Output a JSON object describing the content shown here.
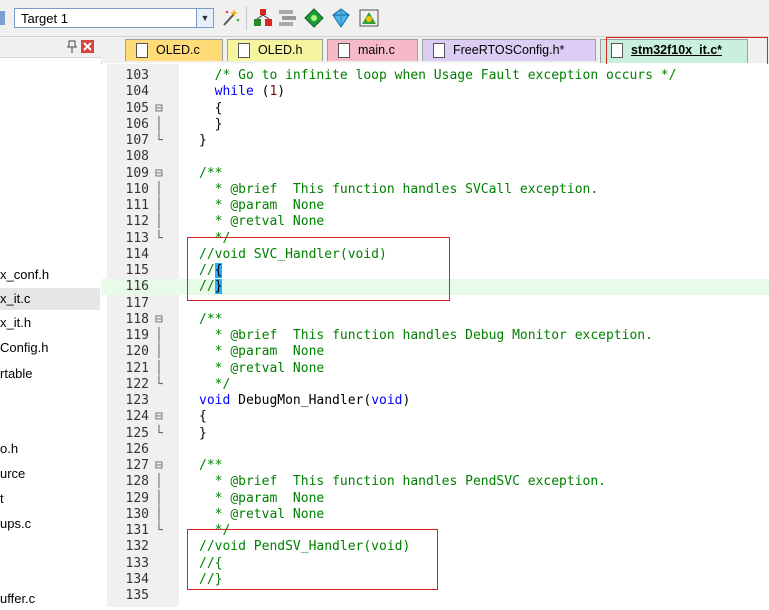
{
  "toolbar": {
    "target": "Target 1",
    "icons": [
      "magic-wand",
      "manage-project-items",
      "file-extensions",
      "select-packs",
      "manage-rte",
      "pack-installer"
    ]
  },
  "left_panel": {
    "items": [
      "x_conf.h",
      "x_it.c",
      "x_it.h",
      "Config.h",
      "rtable",
      "o.h",
      "urce",
      "t",
      "ups.c",
      "uffer.c"
    ],
    "selected_index": 1
  },
  "tabs": [
    {
      "label": "OLED.c",
      "color": "#ffdc78"
    },
    {
      "label": "OLED.h",
      "color": "#f5f5a0"
    },
    {
      "label": "main.c",
      "color": "#f5b9c8"
    },
    {
      "label": "FreeRTOSConfig.h*",
      "color": "#dccdf5"
    },
    {
      "label": "stm32f10x_it.c*",
      "color": "#c8f0dc",
      "active": true
    }
  ],
  "editor": {
    "lines": [
      {
        "n": "103",
        "fold": "",
        "code": "  /* Go to infinite loop when Usage Fault exception occurs */"
      },
      {
        "n": "104",
        "fold": "",
        "code": "  while (1)"
      },
      {
        "n": "105",
        "fold": "⊟",
        "code": "  {"
      },
      {
        "n": "106",
        "fold": "│",
        "code": "  }"
      },
      {
        "n": "107",
        "fold": "└",
        "code": "}"
      },
      {
        "n": "108",
        "fold": "",
        "code": ""
      },
      {
        "n": "109",
        "fold": "⊟",
        "code": "/**"
      },
      {
        "n": "110",
        "fold": "│",
        "code": "  * @brief  This function handles SVCall exception."
      },
      {
        "n": "111",
        "fold": "│",
        "code": "  * @param  None"
      },
      {
        "n": "112",
        "fold": "│",
        "code": "  * @retval None"
      },
      {
        "n": "113",
        "fold": "└",
        "code": "  */"
      },
      {
        "n": "114",
        "fold": "",
        "code": "//void SVC_Handler(void)"
      },
      {
        "n": "115",
        "fold": "",
        "code": "//{"
      },
      {
        "n": "116",
        "fold": "",
        "code": "//}"
      },
      {
        "n": "117",
        "fold": "",
        "code": ""
      },
      {
        "n": "118",
        "fold": "⊟",
        "code": "/**"
      },
      {
        "n": "119",
        "fold": "│",
        "code": "  * @brief  This function handles Debug Monitor exception."
      },
      {
        "n": "120",
        "fold": "│",
        "code": "  * @param  None"
      },
      {
        "n": "121",
        "fold": "│",
        "code": "  * @retval None"
      },
      {
        "n": "122",
        "fold": "└",
        "code": "  */"
      },
      {
        "n": "123",
        "fold": "",
        "code": "void DebugMon_Handler(void)"
      },
      {
        "n": "124",
        "fold": "⊟",
        "code": "{"
      },
      {
        "n": "125",
        "fold": "└",
        "code": "}"
      },
      {
        "n": "126",
        "fold": "",
        "code": ""
      },
      {
        "n": "127",
        "fold": "⊟",
        "code": "/**"
      },
      {
        "n": "128",
        "fold": "│",
        "code": "  * @brief  This function handles PendSVC exception."
      },
      {
        "n": "129",
        "fold": "│",
        "code": "  * @param  None"
      },
      {
        "n": "130",
        "fold": "│",
        "code": "  * @retval None"
      },
      {
        "n": "131",
        "fold": "└",
        "code": "  */"
      },
      {
        "n": "132",
        "fold": "",
        "code": "//void PendSV_Handler(void)"
      },
      {
        "n": "133",
        "fold": "",
        "code": "//{"
      },
      {
        "n": "134",
        "fold": "",
        "code": "//}"
      },
      {
        "n": "135",
        "fold": "",
        "code": ""
      }
    ],
    "current_line": "116"
  }
}
